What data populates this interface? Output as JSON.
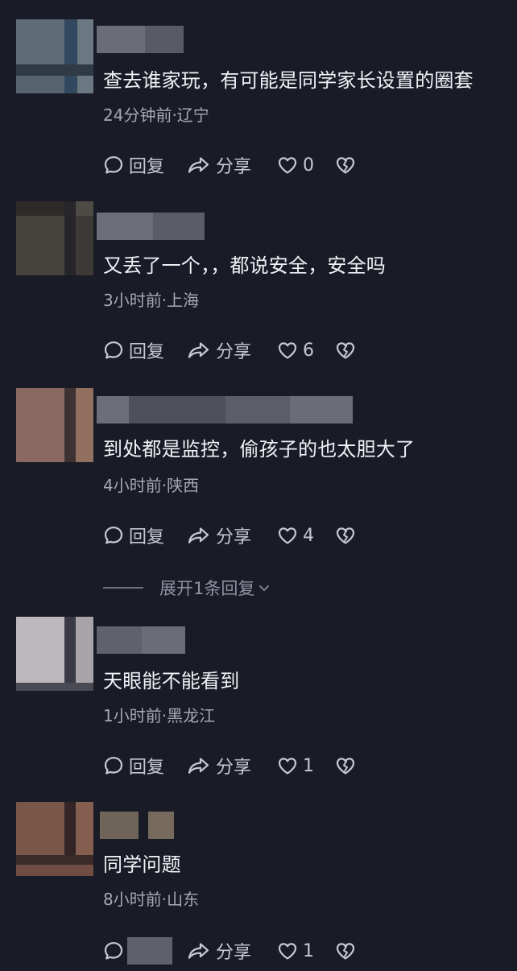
{
  "labels": {
    "reply": "回复",
    "share": "分享"
  },
  "expand_label": "展开1条回复",
  "comments": [
    {
      "text": "查去谁家玩，有可能是同学家长设置的圈套",
      "meta": "24分钟前·辽宁",
      "likes": "0"
    },
    {
      "text": "又丢了一个，，都说安全，安全吗",
      "meta": "3小时前·上海",
      "likes": "6"
    },
    {
      "text": "到处都是监控，偷孩子的也太胆大了",
      "meta": "4小时前·陕西",
      "likes": "4"
    },
    {
      "text": "天眼能不能看到",
      "meta": "1小时前·黑龙江",
      "likes": "1"
    },
    {
      "text": "同学问题",
      "meta": "8小时前·山东",
      "likes": "1"
    }
  ],
  "icons": {
    "reply": "speech-bubble-icon",
    "share": "share-arrow-icon",
    "like": "heart-icon",
    "dislike": "broken-heart-icon",
    "expand": "chevron-down-icon"
  },
  "colors": {
    "background": "#191b26",
    "text": "#f1f2f6",
    "meta": "#a5a9b5",
    "action": "#c6c9d2"
  }
}
